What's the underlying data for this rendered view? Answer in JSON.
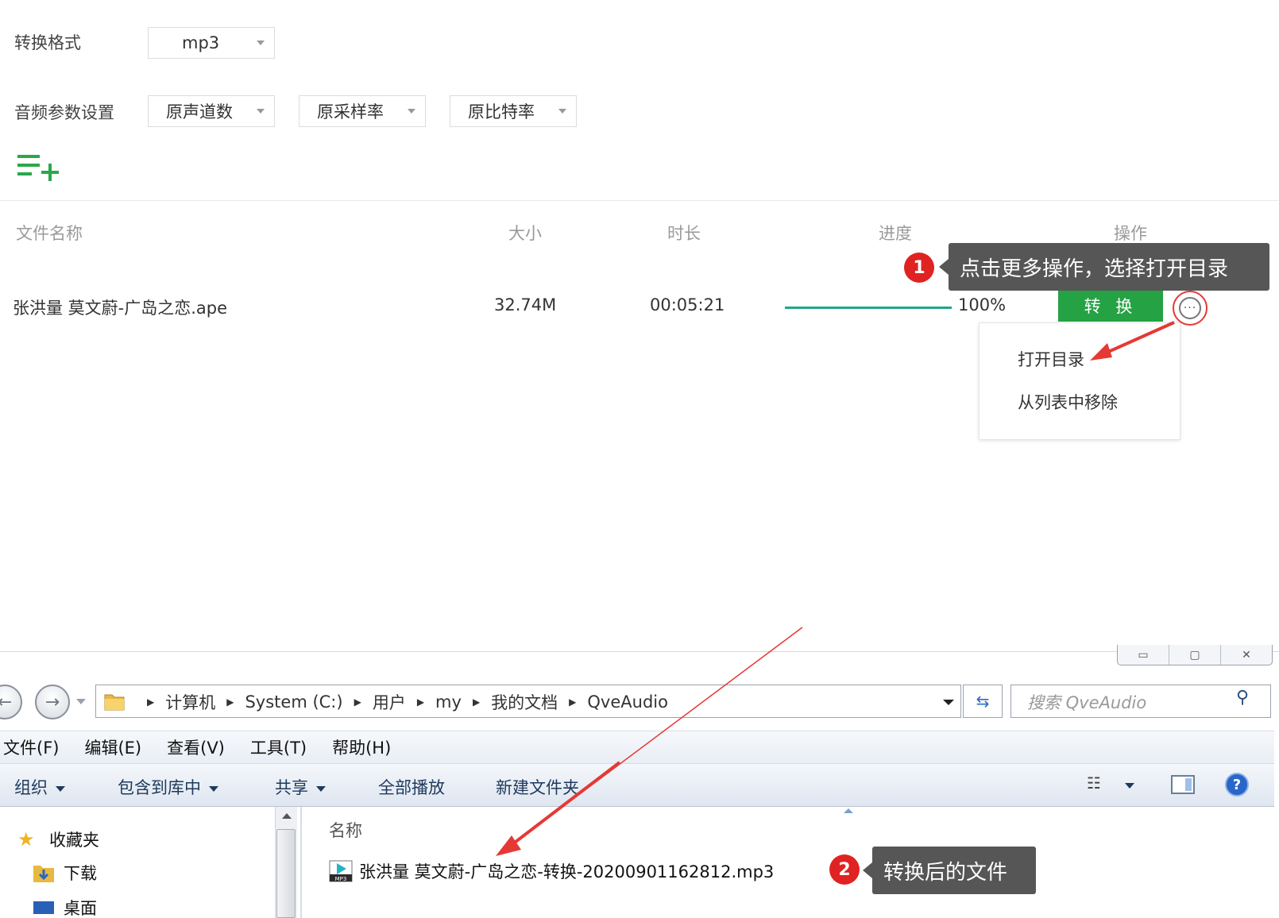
{
  "settings": {
    "format_label": "转换格式",
    "format_value": "mp3",
    "audio_label": "音频参数设置",
    "channels_value": "原声道数",
    "sample_rate_value": "原采样率",
    "bitrate_value": "原比特率"
  },
  "table": {
    "headers": {
      "name": "文件名称",
      "size": "大小",
      "duration": "时长",
      "progress": "进度",
      "action": "操作"
    },
    "rows": [
      {
        "name": "张洪量 莫文蔚-广岛之恋.ape",
        "size": "32.74M",
        "duration": "00:05:21",
        "progress_text": "100%",
        "progress": 1.0,
        "convert_label": "转 换",
        "more_label": "···"
      }
    ]
  },
  "more_menu": {
    "items": [
      "打开目录",
      "从列表中移除"
    ]
  },
  "annotations": {
    "badge1": "1",
    "tip1": "点击更多操作，选择打开目录",
    "badge2": "2",
    "tip2": "转换后的文件"
  },
  "explorer": {
    "breadcrumbs": [
      "计算机",
      "System (C:)",
      "用户",
      "my",
      "我的文档",
      "QveAudio"
    ],
    "search_placeholder": "搜索 QveAudio",
    "menu": [
      "文件(F)",
      "编辑(E)",
      "查看(V)",
      "工具(T)",
      "帮助(H)"
    ],
    "toolbar": {
      "organize": "组织",
      "include_in_library": "包含到库中",
      "share": "共享",
      "play_all": "全部播放",
      "new_folder": "新建文件夹"
    },
    "nav": {
      "favorites": "收藏夹",
      "downloads": "下载",
      "desktop": "桌面"
    },
    "column_name": "名称",
    "file_name": "张洪量 莫文蔚-广岛之恋-转换-20200901162812.mp3",
    "mp3_icon_label": "MP3"
  },
  "colors": {
    "accent_green": "#24a244",
    "progress_teal": "#1ea888",
    "annotation_red": "#e02222",
    "tooltip_gray": "#565656",
    "add_icon_green": "#2aa84a"
  },
  "icons": {
    "add_list": "add-to-list-icon",
    "more": "more-options-icon",
    "folder": "folder-icon",
    "refresh": "refresh-icon",
    "search": "search-icon",
    "help": "help-icon",
    "star": "star-icon",
    "mp3": "mp3-file-icon"
  }
}
